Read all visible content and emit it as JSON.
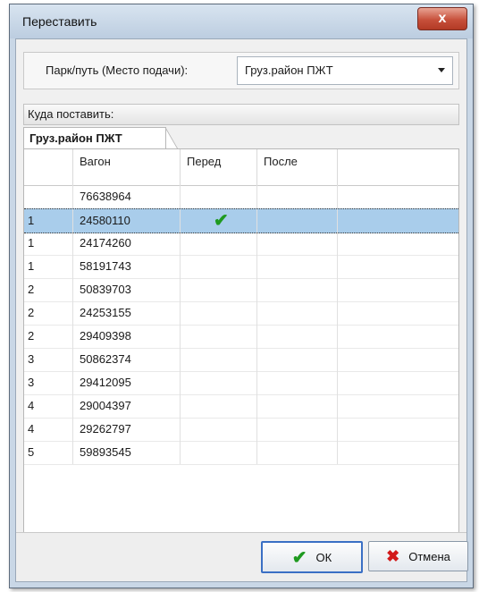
{
  "window": {
    "title": "Переставить",
    "close_glyph": "x"
  },
  "park": {
    "label": "Парк/путь (Место подачи):",
    "value": "Груз.район ПЖТ"
  },
  "destination": {
    "header": "Куда поставить:"
  },
  "tab": {
    "label": "Груз.район ПЖТ"
  },
  "grid": {
    "columns": [
      "Вагон",
      "Перед",
      "После"
    ],
    "rows": [
      {
        "num": "",
        "wagon": "76638964",
        "before": false,
        "after": false
      },
      {
        "num": "1",
        "wagon": "24580110",
        "before": true,
        "after": false,
        "selected": true
      },
      {
        "num": "1",
        "wagon": "24174260",
        "before": false,
        "after": false
      },
      {
        "num": "1",
        "wagon": "58191743",
        "before": false,
        "after": false
      },
      {
        "num": "2",
        "wagon": "50839703",
        "before": false,
        "after": false
      },
      {
        "num": "2",
        "wagon": "24253155",
        "before": false,
        "after": false
      },
      {
        "num": "2",
        "wagon": "29409398",
        "before": false,
        "after": false
      },
      {
        "num": "3",
        "wagon": "50862374",
        "before": false,
        "after": false
      },
      {
        "num": "3",
        "wagon": "29412095",
        "before": false,
        "after": false
      },
      {
        "num": "4",
        "wagon": "29004397",
        "before": false,
        "after": false
      },
      {
        "num": "4",
        "wagon": "29262797",
        "before": false,
        "after": false
      },
      {
        "num": "5",
        "wagon": "59893545",
        "before": false,
        "after": false
      }
    ],
    "check_glyph": "✔",
    "selection_color": "#a9cdeb"
  },
  "buttons": {
    "ok_label": "ОК",
    "ok_icon": "check-icon",
    "cancel_label": "Отмена",
    "cancel_icon": "cross-icon"
  }
}
